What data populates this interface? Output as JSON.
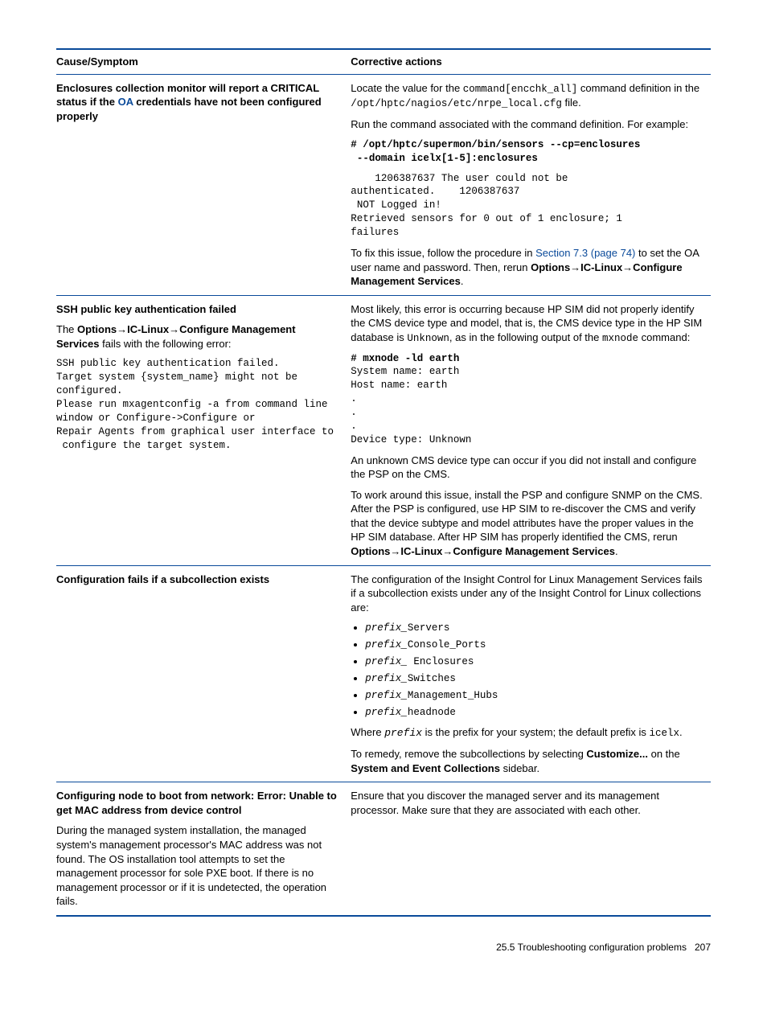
{
  "headers": {
    "left": "Cause/Symptom",
    "right": "Corrective actions"
  },
  "rows": [
    {
      "left": [
        {
          "type": "p",
          "segments": [
            {
              "text": "Enclosures collection monitor will report a CRITICAL status if the ",
              "bold": true
            },
            {
              "text": "OA",
              "bold": true,
              "link": true
            },
            {
              "text": " credentials have not been configured properly",
              "bold": true
            }
          ]
        }
      ],
      "right": [
        {
          "type": "p",
          "segments": [
            {
              "text": "Locate the value for the "
            },
            {
              "text": "command[encchk_all]",
              "mono": true
            },
            {
              "text": " command definition in the "
            },
            {
              "text": "/opt/hptc/nagios/etc/nrpe_local.cfg",
              "mono": true
            },
            {
              "text": " file."
            }
          ]
        },
        {
          "type": "p",
          "segments": [
            {
              "text": "Run the command associated with the command definition. For example:"
            }
          ]
        },
        {
          "type": "mono",
          "text": "# /opt/hptc/supermon/bin/sensors --cp=enclosures\n --domain icelx[1-5]:enclosures"
        },
        {
          "type": "mono",
          "text": "    1206387637 The user could not be\nauthenticated.    1206387637\n NOT Logged in!\nRetrieved sensors for 0 out of 1 enclosure; 1\nfailures"
        },
        {
          "type": "p",
          "segments": [
            {
              "text": "To fix this issue, follow the procedure in "
            },
            {
              "text": "Section 7.3 (page 74)",
              "link": true
            },
            {
              "text": " to set the OA user name and password. Then, rerun "
            },
            {
              "text": "Options→IC-Linux→Configure Management Services",
              "bold": true
            },
            {
              "text": "."
            }
          ]
        }
      ]
    },
    {
      "left": [
        {
          "type": "p",
          "segments": [
            {
              "text": "SSH public key authentication failed",
              "bold": true
            }
          ]
        },
        {
          "type": "p",
          "segments": [
            {
              "text": "The "
            },
            {
              "text": "Options→IC-Linux→Configure Management Services",
              "bold": true
            },
            {
              "text": " fails with the following error:"
            }
          ]
        },
        {
          "type": "mono",
          "text": "SSH public key authentication failed.\nTarget system {system_name} might not be\nconfigured.\nPlease run mxagentconfig -a from command line\nwindow or Configure->Configure or\nRepair Agents from graphical user interface to\n configure the target system."
        }
      ],
      "right": [
        {
          "type": "p",
          "segments": [
            {
              "text": "Most likely, this error is occurring because HP SIM did not properly identify the CMS device type and model, that is, the CMS device type in the HP SIM database is "
            },
            {
              "text": "Unknown",
              "mono": true
            },
            {
              "text": ", as in the following output of the "
            },
            {
              "text": "mxnode",
              "mono": true
            },
            {
              "text": " command:"
            }
          ]
        },
        {
          "type": "mono",
          "text": "# mxnode -ld earth\nSystem name: earth\nHost name: earth\n.\n.\n.\nDevice type: Unknown"
        },
        {
          "type": "p",
          "segments": [
            {
              "text": "An unknown CMS device type can occur if you did not install and configure the PSP on the CMS."
            }
          ]
        },
        {
          "type": "p",
          "segments": [
            {
              "text": "To work around this issue, install the PSP and configure SNMP on the CMS. After the PSP is configured, use HP SIM to re-discover the CMS and verify that the device subtype and model attributes have the proper values in the HP SIM database. After HP SIM has properly identified the CMS, rerun "
            },
            {
              "text": "Options→IC-Linux→Configure Management Services",
              "bold": true
            },
            {
              "text": "."
            }
          ]
        }
      ]
    },
    {
      "left": [
        {
          "type": "p",
          "segments": [
            {
              "text": "Configuration fails if a subcollection exists",
              "bold": true
            }
          ]
        }
      ],
      "right": [
        {
          "type": "p",
          "segments": [
            {
              "text": "The configuration of the Insight Control for Linux Management Services fails if a subcollection exists under any of the Insight Control for Linux collections are:"
            }
          ]
        },
        {
          "type": "ul",
          "items": [
            [
              {
                "text": "prefix_",
                "i": true
              },
              {
                "text": "Servers",
                "mono": true
              }
            ],
            [
              {
                "text": "prefix_",
                "i": true
              },
              {
                "text": "Console_Ports",
                "mono": true
              }
            ],
            [
              {
                "text": "prefix_",
                "i": true
              },
              {
                "text": " Enclosures",
                "mono": true
              }
            ],
            [
              {
                "text": "prefix_",
                "i": true
              },
              {
                "text": "Switches",
                "mono": true
              }
            ],
            [
              {
                "text": "prefix_",
                "i": true
              },
              {
                "text": "Management_Hubs",
                "mono": true
              }
            ],
            [
              {
                "text": "prefix_",
                "i": true
              },
              {
                "text": "headnode",
                "mono": true
              }
            ]
          ]
        },
        {
          "type": "p",
          "segments": [
            {
              "text": "Where "
            },
            {
              "text": "prefix",
              "i": true
            },
            {
              "text": " is the prefix for your system; the default prefix is "
            },
            {
              "text": "icelx",
              "mono": true
            },
            {
              "text": "."
            }
          ]
        },
        {
          "type": "p",
          "segments": [
            {
              "text": "To remedy, remove the subcollections by selecting "
            },
            {
              "text": "Customize...",
              "bold": true
            },
            {
              "text": " on the "
            },
            {
              "text": "System and Event Collections",
              "bold": true
            },
            {
              "text": " sidebar."
            }
          ]
        }
      ]
    },
    {
      "left": [
        {
          "type": "p",
          "segments": [
            {
              "text": "Configuring node to boot from network: Error: Unable to get MAC address from device control",
              "bold": true
            }
          ]
        },
        {
          "type": "p",
          "segments": [
            {
              "text": "During the managed system installation, the managed system's management processor's MAC address was not found. The OS installation tool attempts to set the management processor for sole PXE boot. If there is no management processor or if it is undetected, the operation fails."
            }
          ]
        }
      ],
      "right": [
        {
          "type": "p",
          "segments": [
            {
              "text": "Ensure that you discover the managed server and its management processor. Make sure that they are associated with each other."
            }
          ]
        }
      ]
    }
  ],
  "footer": {
    "section": "25.5 Troubleshooting configuration problems",
    "page": "207"
  }
}
